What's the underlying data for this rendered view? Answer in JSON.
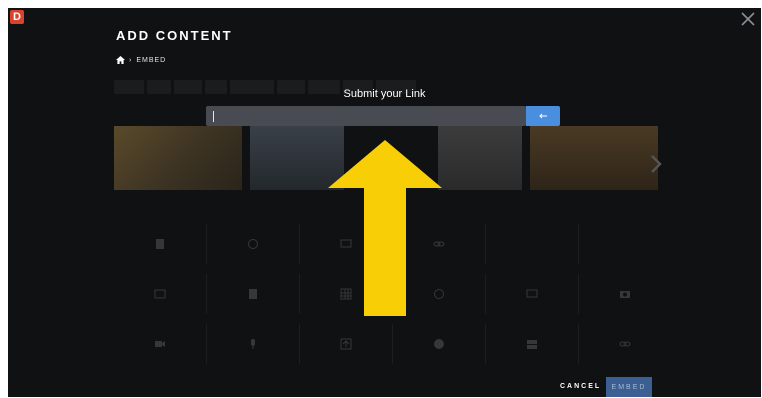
{
  "app": {
    "logo_letter": "D"
  },
  "header": {
    "title": "ADD CONTENT"
  },
  "breadcrumb": {
    "separator": "›",
    "current": "EMBED"
  },
  "modal": {
    "title": "Submit your Link",
    "input_value": "",
    "submit_icon": "arrow-left-icon"
  },
  "footer": {
    "cancel_label": "CANCEL",
    "embed_label": "EMBED"
  },
  "colors": {
    "background": "#101112",
    "logo": "#d9432d",
    "input": "#484c52",
    "submit": "#4a8ee0",
    "embed_button": "#3b5f93",
    "arrow": "#f8cf07"
  }
}
